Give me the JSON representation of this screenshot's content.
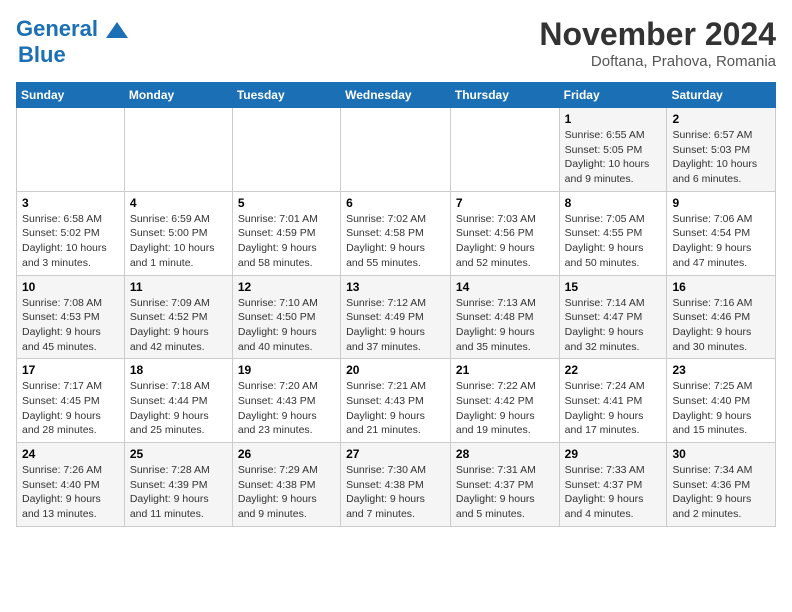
{
  "logo": {
    "line1": "General",
    "line2": "Blue"
  },
  "title": "November 2024",
  "location": "Doftana, Prahova, Romania",
  "days_of_week": [
    "Sunday",
    "Monday",
    "Tuesday",
    "Wednesday",
    "Thursday",
    "Friday",
    "Saturday"
  ],
  "weeks": [
    [
      {
        "day": "",
        "info": ""
      },
      {
        "day": "",
        "info": ""
      },
      {
        "day": "",
        "info": ""
      },
      {
        "day": "",
        "info": ""
      },
      {
        "day": "",
        "info": ""
      },
      {
        "day": "1",
        "info": "Sunrise: 6:55 AM\nSunset: 5:05 PM\nDaylight: 10 hours and 9 minutes."
      },
      {
        "day": "2",
        "info": "Sunrise: 6:57 AM\nSunset: 5:03 PM\nDaylight: 10 hours and 6 minutes."
      }
    ],
    [
      {
        "day": "3",
        "info": "Sunrise: 6:58 AM\nSunset: 5:02 PM\nDaylight: 10 hours and 3 minutes."
      },
      {
        "day": "4",
        "info": "Sunrise: 6:59 AM\nSunset: 5:00 PM\nDaylight: 10 hours and 1 minute."
      },
      {
        "day": "5",
        "info": "Sunrise: 7:01 AM\nSunset: 4:59 PM\nDaylight: 9 hours and 58 minutes."
      },
      {
        "day": "6",
        "info": "Sunrise: 7:02 AM\nSunset: 4:58 PM\nDaylight: 9 hours and 55 minutes."
      },
      {
        "day": "7",
        "info": "Sunrise: 7:03 AM\nSunset: 4:56 PM\nDaylight: 9 hours and 52 minutes."
      },
      {
        "day": "8",
        "info": "Sunrise: 7:05 AM\nSunset: 4:55 PM\nDaylight: 9 hours and 50 minutes."
      },
      {
        "day": "9",
        "info": "Sunrise: 7:06 AM\nSunset: 4:54 PM\nDaylight: 9 hours and 47 minutes."
      }
    ],
    [
      {
        "day": "10",
        "info": "Sunrise: 7:08 AM\nSunset: 4:53 PM\nDaylight: 9 hours and 45 minutes."
      },
      {
        "day": "11",
        "info": "Sunrise: 7:09 AM\nSunset: 4:52 PM\nDaylight: 9 hours and 42 minutes."
      },
      {
        "day": "12",
        "info": "Sunrise: 7:10 AM\nSunset: 4:50 PM\nDaylight: 9 hours and 40 minutes."
      },
      {
        "day": "13",
        "info": "Sunrise: 7:12 AM\nSunset: 4:49 PM\nDaylight: 9 hours and 37 minutes."
      },
      {
        "day": "14",
        "info": "Sunrise: 7:13 AM\nSunset: 4:48 PM\nDaylight: 9 hours and 35 minutes."
      },
      {
        "day": "15",
        "info": "Sunrise: 7:14 AM\nSunset: 4:47 PM\nDaylight: 9 hours and 32 minutes."
      },
      {
        "day": "16",
        "info": "Sunrise: 7:16 AM\nSunset: 4:46 PM\nDaylight: 9 hours and 30 minutes."
      }
    ],
    [
      {
        "day": "17",
        "info": "Sunrise: 7:17 AM\nSunset: 4:45 PM\nDaylight: 9 hours and 28 minutes."
      },
      {
        "day": "18",
        "info": "Sunrise: 7:18 AM\nSunset: 4:44 PM\nDaylight: 9 hours and 25 minutes."
      },
      {
        "day": "19",
        "info": "Sunrise: 7:20 AM\nSunset: 4:43 PM\nDaylight: 9 hours and 23 minutes."
      },
      {
        "day": "20",
        "info": "Sunrise: 7:21 AM\nSunset: 4:43 PM\nDaylight: 9 hours and 21 minutes."
      },
      {
        "day": "21",
        "info": "Sunrise: 7:22 AM\nSunset: 4:42 PM\nDaylight: 9 hours and 19 minutes."
      },
      {
        "day": "22",
        "info": "Sunrise: 7:24 AM\nSunset: 4:41 PM\nDaylight: 9 hours and 17 minutes."
      },
      {
        "day": "23",
        "info": "Sunrise: 7:25 AM\nSunset: 4:40 PM\nDaylight: 9 hours and 15 minutes."
      }
    ],
    [
      {
        "day": "24",
        "info": "Sunrise: 7:26 AM\nSunset: 4:40 PM\nDaylight: 9 hours and 13 minutes."
      },
      {
        "day": "25",
        "info": "Sunrise: 7:28 AM\nSunset: 4:39 PM\nDaylight: 9 hours and 11 minutes."
      },
      {
        "day": "26",
        "info": "Sunrise: 7:29 AM\nSunset: 4:38 PM\nDaylight: 9 hours and 9 minutes."
      },
      {
        "day": "27",
        "info": "Sunrise: 7:30 AM\nSunset: 4:38 PM\nDaylight: 9 hours and 7 minutes."
      },
      {
        "day": "28",
        "info": "Sunrise: 7:31 AM\nSunset: 4:37 PM\nDaylight: 9 hours and 5 minutes."
      },
      {
        "day": "29",
        "info": "Sunrise: 7:33 AM\nSunset: 4:37 PM\nDaylight: 9 hours and 4 minutes."
      },
      {
        "day": "30",
        "info": "Sunrise: 7:34 AM\nSunset: 4:36 PM\nDaylight: 9 hours and 2 minutes."
      }
    ]
  ]
}
